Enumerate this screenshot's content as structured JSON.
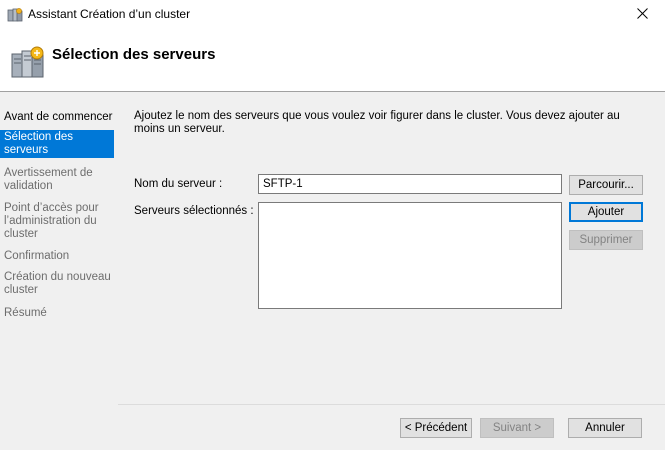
{
  "window": {
    "title": "Assistant Création d’un cluster",
    "close_icon": "close-icon",
    "app_icon": "cluster-app-icon"
  },
  "header": {
    "title": "Sélection des serveurs",
    "icon": "server-cluster-icon"
  },
  "sidebar": {
    "items": [
      {
        "label": "Avant de commencer",
        "state": "done"
      },
      {
        "label": "Sélection des serveurs",
        "state": "active"
      },
      {
        "label": "Avertissement de validation",
        "state": "pending"
      },
      {
        "label": "Point d’accès pour l’administration du cluster",
        "state": "pending"
      },
      {
        "label": "Confirmation",
        "state": "pending"
      },
      {
        "label": "Création du nouveau cluster",
        "state": "pending"
      },
      {
        "label": "Résumé",
        "state": "pending"
      }
    ]
  },
  "main": {
    "description": "Ajoutez le nom des serveurs que vous voulez voir figurer dans le cluster. Vous devez ajouter au moins un serveur.",
    "server_name_label": "Nom du serveur :",
    "server_name_value": "SFTP-1",
    "selected_servers_label": "Serveurs sélectionnés :",
    "selected_servers": [],
    "browse_button": "Parcourir...",
    "add_button": "Ajouter",
    "remove_button": "Supprimer"
  },
  "footer": {
    "previous_button": "< Précédent",
    "next_button": "Suivant >",
    "cancel_button": "Annuler"
  },
  "colors": {
    "accent": "#0078d7",
    "panel_bg": "#f0f0f0"
  }
}
